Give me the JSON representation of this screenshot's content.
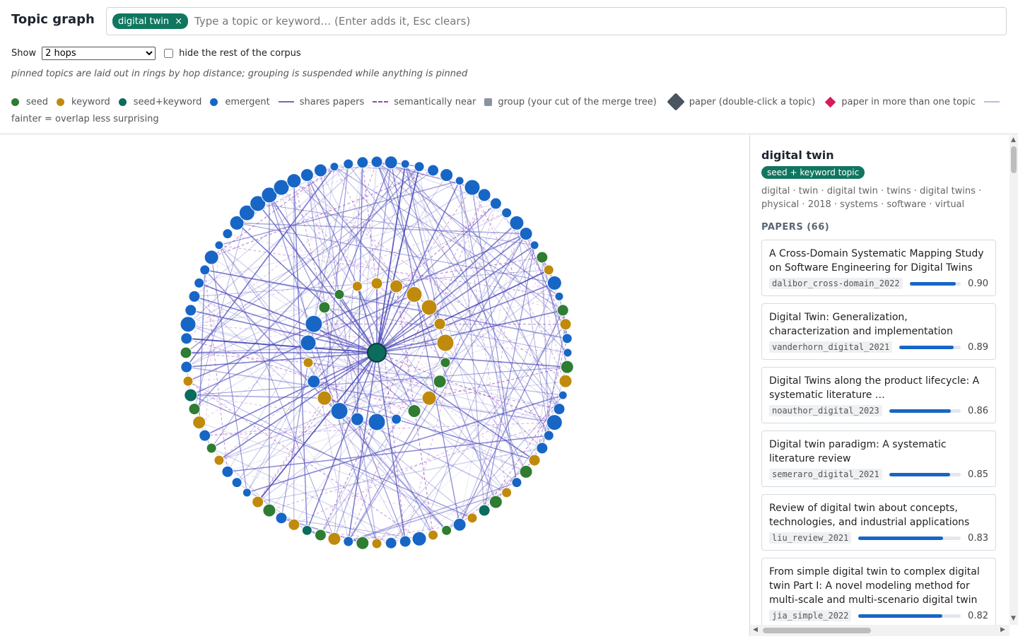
{
  "header": {
    "title": "Topic graph",
    "chip_label": "digital twin",
    "chip_close": "×",
    "search_placeholder": "Type a topic or keyword… (Enter adds it, Esc clears)"
  },
  "controls": {
    "show_label": "Show",
    "show_value": "2 hops",
    "hide_label": "hide the rest of the corpus",
    "hide_checked": false,
    "note": "pinned topics are laid out in rings by hop distance; grouping is suspended while anything is pinned"
  },
  "legend": {
    "seed": "seed",
    "keyword": "keyword",
    "seed_keyword": "seed+keyword",
    "emergent": "emergent",
    "shares_papers": "shares papers",
    "semantically_near": "semantically near",
    "group": "group (your cut of the merge tree)",
    "paper": "paper (double-click a topic)",
    "paper_multi": "paper in more than one topic",
    "fainter": "fainter = overlap less surprising",
    "colors": {
      "seed": "#2e7d32",
      "keyword": "#c08a0c",
      "seed_keyword": "#0b6b5c",
      "emergent": "#1766c6"
    }
  },
  "graph": {
    "node_counts": {
      "seed": 22,
      "keyword": 34,
      "seed_keyword": 5,
      "emergent": 45
    }
  },
  "detail": {
    "title": "digital twin",
    "badge": "seed + keyword topic",
    "keywords": "digital · twin · digital twin · twins · digital twins · physical · 2018 · systems · software · virtual",
    "papers_header": "PAPERS (66)",
    "papers": [
      {
        "title": "A Cross-Domain Systematic Mapping Study on Software Engineering for Digital Twins",
        "key": "dalibor_cross-domain_2022",
        "score": "0.90",
        "score_value": 0.9
      },
      {
        "title": "Digital Twin: Generalization, characterization and implementation",
        "key": "vanderhorn_digital_2021",
        "score": "0.89",
        "score_value": 0.89
      },
      {
        "title": "Digital Twins along the product lifecycle: A systematic literature …",
        "key": "noauthor_digital_2023",
        "score": "0.86",
        "score_value": 0.86
      },
      {
        "title": "Digital twin paradigm: A systematic literature review",
        "key": "semeraro_digital_2021",
        "score": "0.85",
        "score_value": 0.85
      },
      {
        "title": "Review of digital twin about concepts, technologies, and industrial applications",
        "key": "liu_review_2021",
        "score": "0.83",
        "score_value": 0.83
      },
      {
        "title": "From simple digital twin to complex digital twin Part I: A novel modeling method for multi-scale and multi-scenario digital twin",
        "key": "jia_simple_2022",
        "score": "0.82",
        "score_value": 0.82
      }
    ]
  }
}
